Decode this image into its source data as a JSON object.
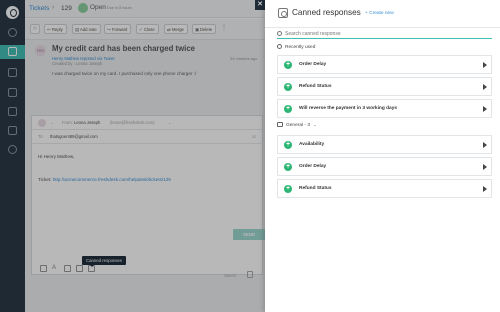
{
  "header": {
    "breadcrumb": "Tickets",
    "separator": "›",
    "ticket_number": "129",
    "status": "Open",
    "due": "Due in 8 hours"
  },
  "toolbar": {
    "buttons": [
      "Reply",
      "Add note",
      "Forward",
      "Close",
      "Merge",
      "Delete"
    ],
    "more": "⋮"
  },
  "ticket": {
    "avatar_initials": "HM",
    "subject": "My credit card has been charged twice",
    "reported_by": "Henry Mathew reported via Tweet",
    "created_by": "Created by : Leona Joseph",
    "time_ago": "34 minutes ago",
    "body": "I was charged twice on my card. I purchased only one phone charger :/"
  },
  "reply": {
    "from_label": "From:",
    "from_name": "Leona Joseph",
    "from_email": "(leona@freshdesk.com)",
    "to_label": "To:",
    "to_email": "thatsgoer489@gmail.com",
    "cc": "cc",
    "greeting": "Hi Henry Mathew,",
    "ticket_link_label": "Ticket:",
    "ticket_link": "http://acmecommerce.freshdesk.com/helpdesk/tickets/129",
    "tooltip": "Canned responses",
    "save_label": "Saved",
    "send_label": "SEND"
  },
  "panel": {
    "title": "Canned responses",
    "create_link": "+ Create new",
    "search_placeholder": "Search canned response",
    "recent_label": "Recently used",
    "recent_items": [
      "Order Delay",
      "Refund Status",
      "Will reverse the payment in 3 working days"
    ],
    "folder_label": "General - 3",
    "folder_items": [
      "Availability",
      "Order Delay",
      "Refund Status"
    ]
  },
  "colors": {
    "accent": "#3fbfb3",
    "link": "#3a8fd6",
    "insert": "#2bb673",
    "rail": "#2a3a48"
  }
}
